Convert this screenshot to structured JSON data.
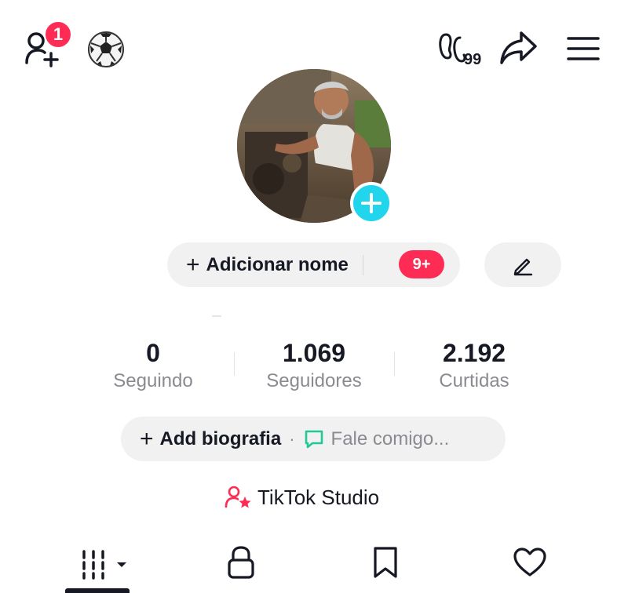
{
  "header": {
    "notification_count": "1",
    "icons": [
      "add-friend-icon",
      "soccer-ball-icon",
      "footprint-icon",
      "share-icon",
      "menu-icon"
    ],
    "footprint_count": "99"
  },
  "profile": {
    "add_name_label": "Adicionar nome",
    "add_name_plus": "+",
    "name_badge": "9+"
  },
  "stats": [
    {
      "value": "0",
      "label": "Seguindo"
    },
    {
      "value": "1.069",
      "label": "Seguidores"
    },
    {
      "value": "2.192",
      "label": "Curtidas"
    }
  ],
  "bio": {
    "plus": "+",
    "add_label": "Add biografia",
    "separator": "·",
    "contact_placeholder": "Fale comigo..."
  },
  "studio": {
    "label": "TikTok Studio"
  },
  "tabs": [
    {
      "icon": "grid-icon",
      "active": true
    },
    {
      "icon": "lock-icon",
      "active": false
    },
    {
      "icon": "bookmark-icon",
      "active": false
    },
    {
      "icon": "heart-icon",
      "active": false
    }
  ],
  "colors": {
    "accent_red": "#fe2c55",
    "accent_cyan": "#20d5ec",
    "chat_green": "#20c997",
    "pill_bg": "#f1f1f2",
    "muted_text": "#8a8b91"
  }
}
